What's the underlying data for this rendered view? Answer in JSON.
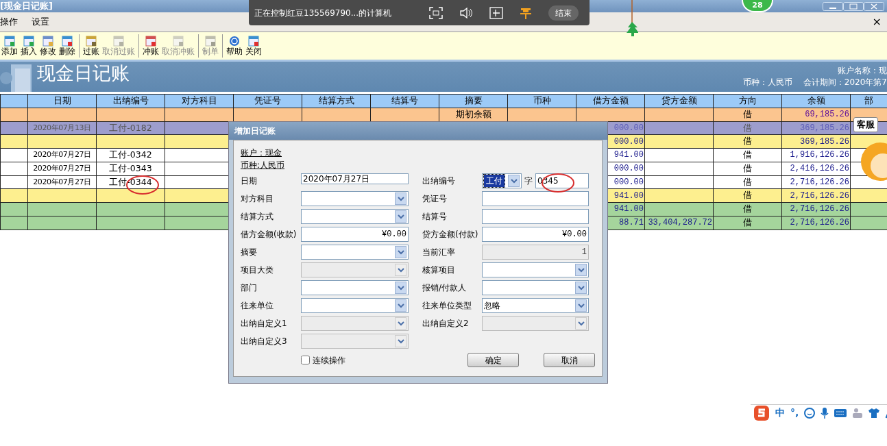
{
  "window": {
    "title": "[现金日记账]",
    "badge": "28"
  },
  "remote_bar": {
    "text": "正在控制红豆135569790...的计算机",
    "end_button": "结束"
  },
  "menu": {
    "items": [
      {
        "label": "操作"
      },
      {
        "label": "设置"
      }
    ],
    "close": "×"
  },
  "toolbar": [
    [
      {
        "label": "添加",
        "disabled": false
      },
      {
        "label": "插入",
        "disabled": false
      },
      {
        "label": "修改",
        "disabled": false
      },
      {
        "label": "删除",
        "disabled": false
      }
    ],
    [
      {
        "label": "过账",
        "disabled": false
      },
      {
        "label": "取消过账",
        "disabled": true
      }
    ],
    [
      {
        "label": "冲账",
        "disabled": false
      },
      {
        "label": "取消冲账",
        "disabled": true
      }
    ],
    [
      {
        "label": "制单",
        "disabled": true
      }
    ],
    [
      {
        "label": "帮助",
        "disabled": false
      },
      {
        "label": "关闭",
        "disabled": false
      }
    ]
  ],
  "header": {
    "title": "现金日记账",
    "account": "账户名称：现",
    "currency": "币种：人民币",
    "period": "会计期间：2020年第7"
  },
  "table": {
    "columns": [
      "日期",
      "出纳编号",
      "对方科目",
      "凭证号",
      "结算方式",
      "结算号",
      "摘要",
      "币种",
      "借方金额",
      "贷方金额",
      "方向",
      "余额",
      "部"
    ],
    "rows": [
      {
        "kind": "opening",
        "selected": false,
        "summary": "期初余额",
        "direction": "借",
        "balance": "69,185.26"
      },
      {
        "kind": "entry",
        "selected": true,
        "date": "2020年07月13日",
        "number": "工付-0182",
        "debit": "000.00",
        "direction": "借",
        "balance": "369,185.26"
      },
      {
        "kind": "subtotal",
        "selected": false,
        "debit": "000.00",
        "direction": "借",
        "balance": "369,185.26"
      },
      {
        "kind": "entry",
        "selected": false,
        "date": "2020年07月27日",
        "number": "工付-0342",
        "debit": "941.00",
        "direction": "借",
        "balance": "1,916,126.26"
      },
      {
        "kind": "entry",
        "selected": false,
        "date": "2020年07月27日",
        "number": "工付-0343",
        "debit": "000.00",
        "direction": "借",
        "balance": "2,416,126.26"
      },
      {
        "kind": "entry",
        "selected": false,
        "date": "2020年07月27日",
        "number": "工付-0344",
        "debit": "000.00",
        "direction": "借",
        "balance": "2,716,126.26"
      },
      {
        "kind": "subtotal",
        "selected": false,
        "debit": "941.00",
        "direction": "借",
        "balance": "2,716,126.26"
      },
      {
        "kind": "total",
        "selected": false,
        "debit": "941.00",
        "direction": "借",
        "balance": "2,716,126.26"
      },
      {
        "kind": "total",
        "selected": false,
        "debit": "88.71",
        "credit": "33,404,287.72",
        "direction": "借",
        "balance": "2,716,126.26"
      }
    ]
  },
  "dialog": {
    "title": "增加日记账",
    "account_link": "账户：现金",
    "currency_link": "币种:人民币",
    "left_fields": [
      {
        "label": "日期",
        "kind": "text",
        "disabled": false,
        "value": "2020年07月27日"
      },
      {
        "label": "对方科目",
        "kind": "select",
        "disabled": false
      },
      {
        "label": "结算方式",
        "kind": "select",
        "disabled": false
      },
      {
        "label": "借方金额(收款)",
        "kind": "amount",
        "disabled": false,
        "value": "¥0.00"
      },
      {
        "label": "摘要",
        "kind": "select",
        "disabled": false
      },
      {
        "label": "项目大类",
        "kind": "select",
        "disabled": true
      },
      {
        "label": "部门",
        "kind": "select",
        "disabled": false
      },
      {
        "label": "往来单位",
        "kind": "select",
        "disabled": false
      },
      {
        "label": "出纳自定义1",
        "kind": "select",
        "disabled": true
      },
      {
        "label": "出纳自定义3",
        "kind": "select",
        "disabled": true
      }
    ],
    "right_fields": [
      {
        "label": "出纳编号",
        "kind": "code",
        "disabled": false,
        "prefix": "工付",
        "separator": "字",
        "value": "0345"
      },
      {
        "label": "凭证号",
        "kind": "text",
        "disabled": false
      },
      {
        "label": "结算号",
        "kind": "text",
        "disabled": false
      },
      {
        "label": "贷方金额(付款)",
        "kind": "amount",
        "disabled": false,
        "value": "¥0.00"
      },
      {
        "label": "当前汇率",
        "kind": "amount",
        "disabled": true,
        "value": "1"
      },
      {
        "label": "核算项目",
        "kind": "select",
        "disabled": false
      },
      {
        "label": "报销/付款人",
        "kind": "select",
        "disabled": false
      },
      {
        "label": "往来单位类型",
        "kind": "select",
        "disabled": false,
        "value": "忽略"
      },
      {
        "label": "出纳自定义2",
        "kind": "select",
        "disabled": true
      }
    ],
    "continuous": {
      "label": "连续操作",
      "checked": false
    },
    "buttons": [
      "确定",
      "取消"
    ]
  },
  "service_label": "客服",
  "ime": {
    "mode": "中",
    "punct": "°,"
  }
}
